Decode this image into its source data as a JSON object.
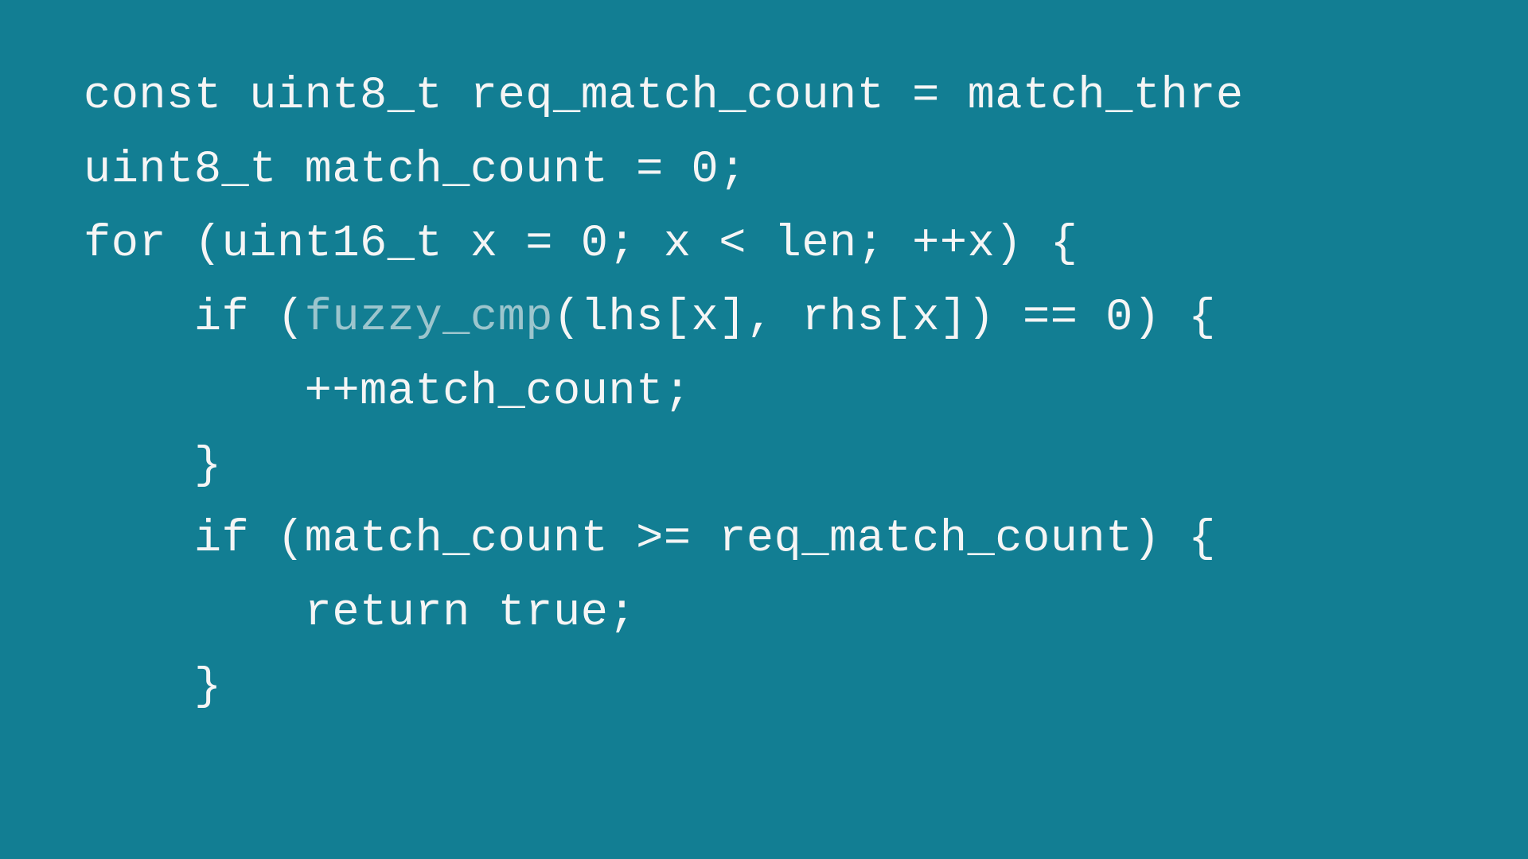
{
  "code": {
    "lines": [
      {
        "segments": [
          {
            "text": "const uint8_t req_match_count = match_thre",
            "highlighted": false
          }
        ]
      },
      {
        "segments": [
          {
            "text": "uint8_t match_count = 0;",
            "highlighted": false
          }
        ]
      },
      {
        "segments": [
          {
            "text": "for (uint16_t x = 0; x < len; ++x) {",
            "highlighted": false
          }
        ]
      },
      {
        "segments": [
          {
            "text": "    if (",
            "highlighted": false
          },
          {
            "text": "fuzzy_cmp",
            "highlighted": true
          },
          {
            "text": "(lhs[x], rhs[x]) == 0) {",
            "highlighted": false
          }
        ]
      },
      {
        "segments": [
          {
            "text": "        ++match_count;",
            "highlighted": false
          }
        ]
      },
      {
        "segments": [
          {
            "text": "    }",
            "highlighted": false
          }
        ]
      },
      {
        "segments": [
          {
            "text": "    if (match_count >= req_match_count) {",
            "highlighted": false
          }
        ]
      },
      {
        "segments": [
          {
            "text": "        return true;",
            "highlighted": false
          }
        ]
      },
      {
        "segments": [
          {
            "text": "    }",
            "highlighted": false
          }
        ]
      }
    ]
  }
}
